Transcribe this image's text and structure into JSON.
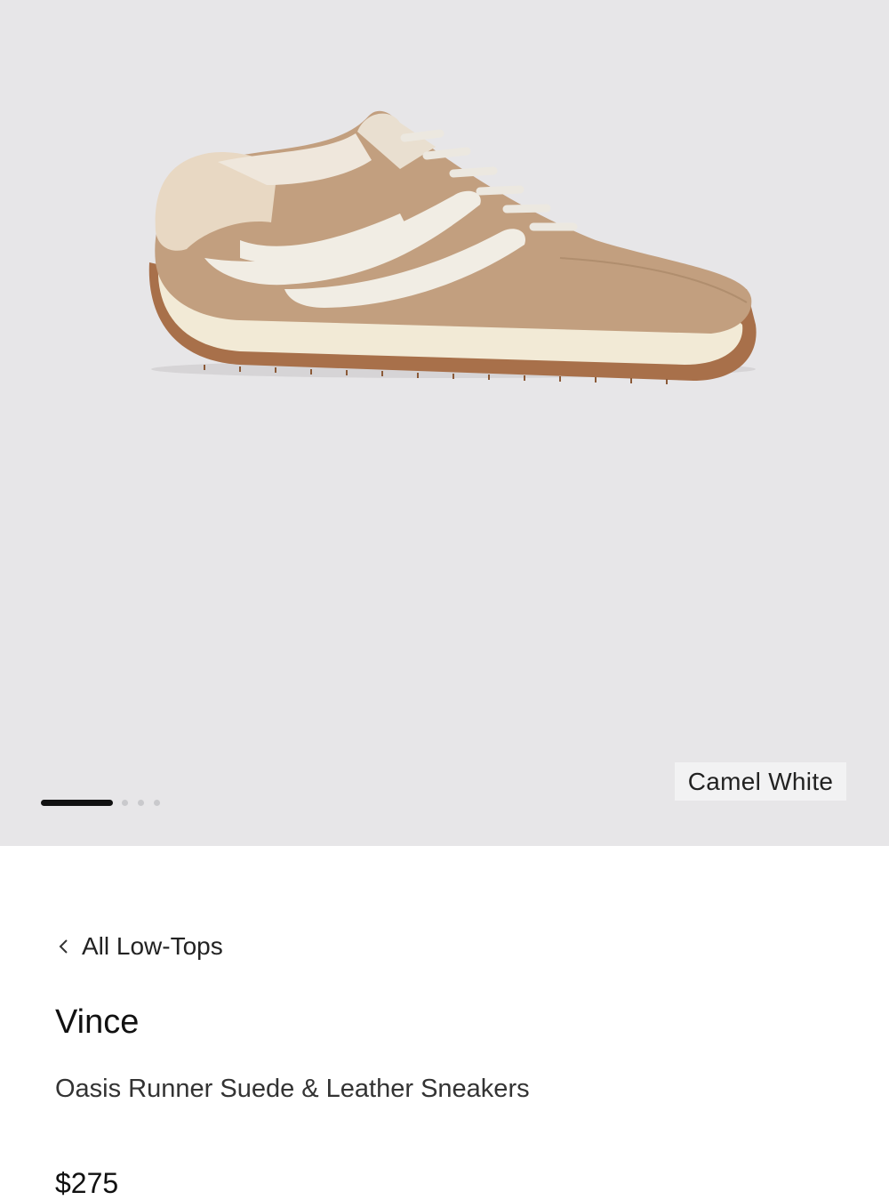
{
  "gallery": {
    "image_subject": "suede-leather-sneaker",
    "color_label": "Camel White",
    "slide_count": 4,
    "active_slide": 1,
    "colors": {
      "background": "#e7e6e8",
      "suede": "#c29f7f",
      "leather_stripe": "#f1ede4",
      "sole": "#a5704c",
      "midsole": "#f2ead6"
    }
  },
  "breadcrumb": {
    "icon": "chevron-left-icon",
    "label": "All Low-Tops"
  },
  "product": {
    "brand": "Vince",
    "name": "Oasis Runner Suede & Leather Sneakers",
    "price": "$275"
  }
}
